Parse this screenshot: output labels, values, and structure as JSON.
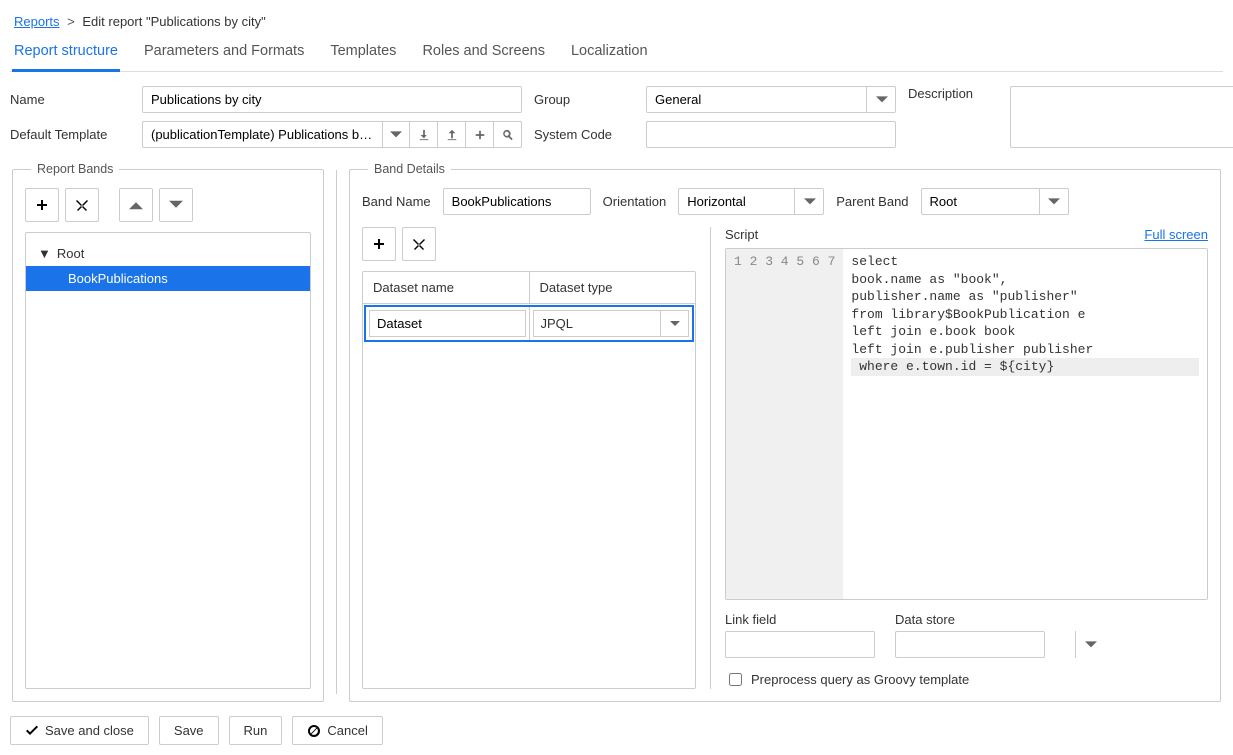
{
  "breadcrumb": {
    "root_link": "Reports",
    "current": "Edit report \"Publications by city\""
  },
  "tabs": [
    {
      "label": "Report structure",
      "active": true
    },
    {
      "label": "Parameters and Formats",
      "active": false
    },
    {
      "label": "Templates",
      "active": false
    },
    {
      "label": "Roles and Screens",
      "active": false
    },
    {
      "label": "Localization",
      "active": false
    }
  ],
  "form": {
    "name_label": "Name",
    "name_value": "Publications by city",
    "group_label": "Group",
    "group_value": "General",
    "description_label": "Description",
    "description_value": "",
    "default_template_label": "Default Template",
    "default_template_value": "(publicationTemplate) Publications by city.docx",
    "system_code_label": "System Code",
    "system_code_value": ""
  },
  "report_bands": {
    "legend": "Report Bands",
    "tree": [
      {
        "label": "Root",
        "selected": false,
        "indent": 0,
        "expandable": true
      },
      {
        "label": "BookPublications",
        "selected": true,
        "indent": 1,
        "expandable": false
      }
    ]
  },
  "band_details": {
    "legend": "Band Details",
    "band_name_label": "Band Name",
    "band_name_value": "BookPublications",
    "orientation_label": "Orientation",
    "orientation_value": "Horizontal",
    "parent_band_label": "Parent Band",
    "parent_band_value": "Root",
    "dataset_table": {
      "headers": [
        "Dataset name",
        "Dataset type"
      ],
      "rows": [
        {
          "name": "Dataset",
          "type": "JPQL"
        }
      ]
    },
    "script_label": "Script",
    "full_screen_label": "Full screen",
    "script_lines": [
      "select",
      "book.name as \"book\",",
      "publisher.name as \"publisher\"",
      "from library$BookPublication e",
      "left join e.book book",
      "left join e.publisher publisher",
      " where e.town.id = ${city}"
    ],
    "link_field_label": "Link field",
    "link_field_value": "",
    "data_store_label": "Data store",
    "data_store_value": "",
    "preprocess_label": "Preprocess query as Groovy template",
    "preprocess_checked": false
  },
  "footer": {
    "save_close": "Save and close",
    "save": "Save",
    "run": "Run",
    "cancel": "Cancel"
  }
}
